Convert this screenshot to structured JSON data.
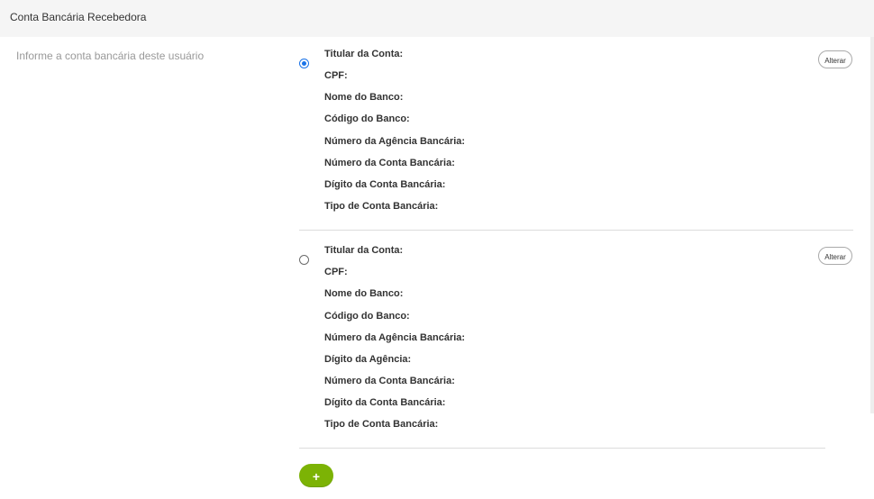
{
  "header": {
    "title": "Conta Bancária Recebedora"
  },
  "description": "Informe a conta bancária deste usuário",
  "accounts": [
    {
      "selected": true,
      "alter_label": "Alterar",
      "fields": [
        "Titular da Conta:",
        "CPF:",
        "Nome do Banco:",
        "Código do Banco:",
        "Número da Agência Bancária:",
        "Número da Conta Bancária:",
        "Dígito da Conta Bancária:",
        "Tipo de Conta Bancária:"
      ]
    },
    {
      "selected": false,
      "alter_label": "Alterar",
      "fields": [
        "Titular da Conta:",
        "CPF:",
        "Nome do Banco:",
        "Código do Banco:",
        "Número da Agência Bancária:",
        "Dígito da Agência:",
        "Número da Conta Bancária:",
        "Dígito da Conta Bancária:",
        "Tipo de Conta Bancária:"
      ]
    }
  ],
  "add_button": {
    "label": "+"
  },
  "colors": {
    "accent_green": "#7cb305",
    "radio_blue": "#1a73e8"
  }
}
